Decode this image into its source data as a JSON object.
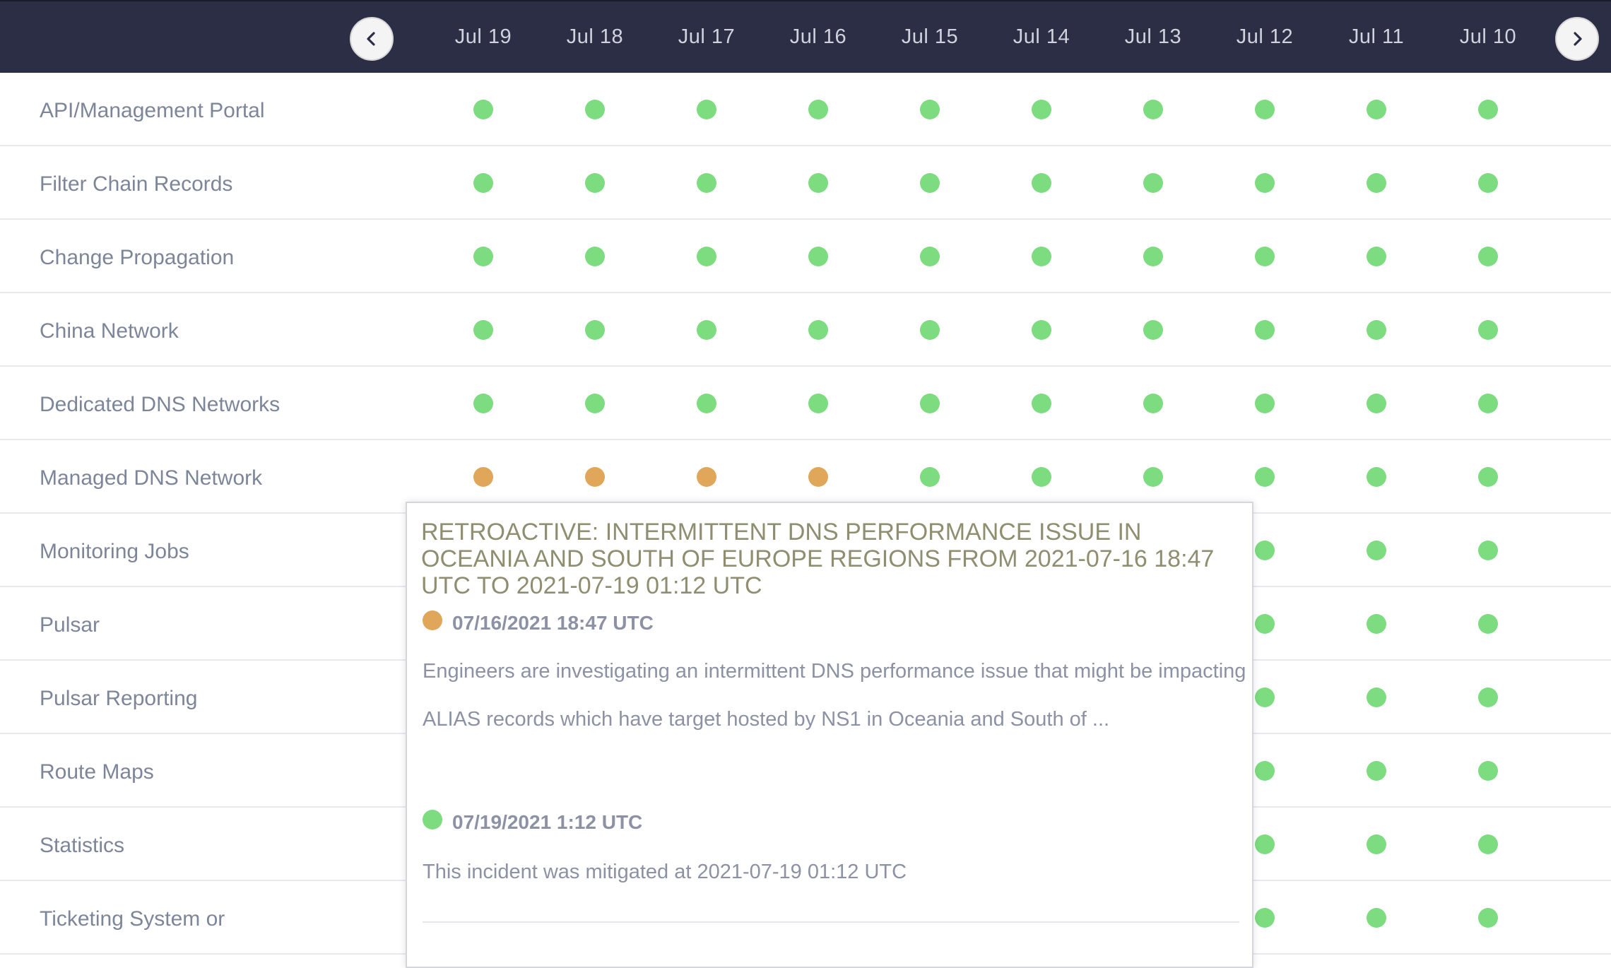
{
  "colors": {
    "header_bg": "#2b2e44",
    "operational": "#7ddc7f",
    "degraded": "#e0a65a",
    "label_text": "#7d8599",
    "popup_title": "#8f8e70"
  },
  "nav": {
    "prev_icon": "chevron-left-icon",
    "next_icon": "chevron-right-icon"
  },
  "dates": [
    "Jul 19",
    "Jul 18",
    "Jul 17",
    "Jul 16",
    "Jul 15",
    "Jul 14",
    "Jul 13",
    "Jul 12",
    "Jul 11",
    "Jul 10"
  ],
  "components": [
    {
      "name": "API/Management Portal",
      "statuses": [
        "operational",
        "operational",
        "operational",
        "operational",
        "operational",
        "operational",
        "operational",
        "operational",
        "operational",
        "operational"
      ]
    },
    {
      "name": "Filter Chain Records",
      "statuses": [
        "operational",
        "operational",
        "operational",
        "operational",
        "operational",
        "operational",
        "operational",
        "operational",
        "operational",
        "operational"
      ]
    },
    {
      "name": "Change Propagation",
      "statuses": [
        "operational",
        "operational",
        "operational",
        "operational",
        "operational",
        "operational",
        "operational",
        "operational",
        "operational",
        "operational"
      ]
    },
    {
      "name": "China Network",
      "statuses": [
        "operational",
        "operational",
        "operational",
        "operational",
        "operational",
        "operational",
        "operational",
        "operational",
        "operational",
        "operational"
      ]
    },
    {
      "name": "Dedicated DNS Networks",
      "statuses": [
        "operational",
        "operational",
        "operational",
        "operational",
        "operational",
        "operational",
        "operational",
        "operational",
        "operational",
        "operational"
      ]
    },
    {
      "name": "Managed DNS Network",
      "statuses": [
        "degraded",
        "degraded",
        "degraded",
        "degraded",
        "operational",
        "operational",
        "operational",
        "operational",
        "operational",
        "operational"
      ]
    },
    {
      "name": "Monitoring Jobs",
      "statuses": [
        "operational",
        "operational",
        "operational",
        "operational",
        "operational",
        "operational",
        "operational",
        "operational",
        "operational",
        "operational"
      ]
    },
    {
      "name": "Pulsar",
      "statuses": [
        "operational",
        "operational",
        "operational",
        "operational",
        "operational",
        "operational",
        "operational",
        "operational",
        "operational",
        "operational"
      ]
    },
    {
      "name": "Pulsar Reporting",
      "statuses": [
        "operational",
        "operational",
        "operational",
        "operational",
        "operational",
        "operational",
        "operational",
        "operational",
        "operational",
        "operational"
      ]
    },
    {
      "name": "Route Maps",
      "statuses": [
        "operational",
        "operational",
        "operational",
        "operational",
        "operational",
        "operational",
        "operational",
        "operational",
        "operational",
        "operational"
      ]
    },
    {
      "name": "Statistics",
      "statuses": [
        "operational",
        "operational",
        "operational",
        "operational",
        "operational",
        "operational",
        "operational",
        "operational",
        "operational",
        "operational"
      ]
    },
    {
      "name": "Ticketing System or",
      "statuses": [
        "operational",
        "operational",
        "operational",
        "operational",
        "operational",
        "operational",
        "operational",
        "operational",
        "operational",
        "operational"
      ]
    }
  ],
  "incident": {
    "title": "RETROACTIVE: INTERMITTENT DNS PERFORMANCE ISSUE IN OCEANIA AND SOUTH OF EUROPE REGIONS FROM 2021-07-16 18:47 UTC TO 2021-07-19 01:12 UTC",
    "updates": [
      {
        "status": "degraded",
        "time": "07/16/2021 18:47 UTC",
        "text": "Engineers are investigating an intermittent DNS performance issue that might be impacting ALIAS records which have target hosted by NS1 in Oceania and South of ..."
      },
      {
        "status": "operational",
        "time": "07/19/2021 1:12 UTC",
        "text": "This incident was mitigated at 2021-07-19 01:12 UTC"
      }
    ]
  }
}
